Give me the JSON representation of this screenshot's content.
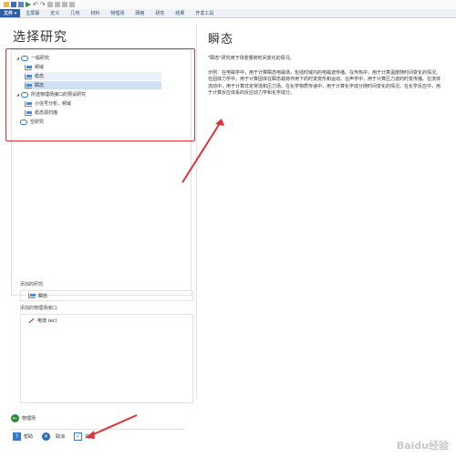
{
  "ribbon": {
    "tabs": [
      "文件 ▾",
      "主屏幕",
      "定义",
      "几何",
      "材料",
      "物理场",
      "网格",
      "研究",
      "结果",
      "开发工具"
    ]
  },
  "wizard": {
    "title": "选择研究",
    "tree": [
      {
        "label": "一般研究",
        "level": 0,
        "expand": "◢",
        "icon": "study"
      },
      {
        "label": "频域",
        "level": 1,
        "icon": "step"
      },
      {
        "label": "稳态",
        "level": 1,
        "icon": "step"
      },
      {
        "label": "瞬态",
        "level": 1,
        "icon": "step",
        "selected": true
      },
      {
        "label": "所选物理场接口的预设研究",
        "level": 0,
        "expand": "◢",
        "icon": "study"
      },
      {
        "label": "小信号分析，频域",
        "level": 1,
        "icon": "step"
      },
      {
        "label": "稳态源扫描",
        "level": 1,
        "icon": "step"
      },
      {
        "label": "空研究",
        "level": 0,
        "icon": "study"
      }
    ],
    "added_studies_label": "添加的研究:",
    "added_study": "瞬态",
    "added_physics_label": "添加的物理场接口:",
    "added_physics": "电流 (ec)",
    "physics_button": "物理场",
    "help_button": "帮助",
    "cancel_button": "取消",
    "finish_button": "完成"
  },
  "description": {
    "title": "瞬态",
    "line1": "\"瞬态\"研究用于场变量随时间变化的情况。",
    "line2": "示例：在电磁学中，用于计算瞬态电磁场，包括时域内的电磁波传播。在传热中，用于计算温度随时间变化的情况。在固体力学中，用于计算固体在瞬态载荷作用下的时变变形和运动。在声学中，用于计算压力波的时变传播。在流体流动中，用于计算非定常流和压力场。在化学物质传递中，用于计算化学成分随时间变化的情况。在化学反应中，用于计算反应体系的反应动力学和化学成分。"
  },
  "watermark": "Baidu经验",
  "colors": {
    "annotation": "#e0303a",
    "selected": "#cfe0f5",
    "accent": "#2d5fa8"
  }
}
